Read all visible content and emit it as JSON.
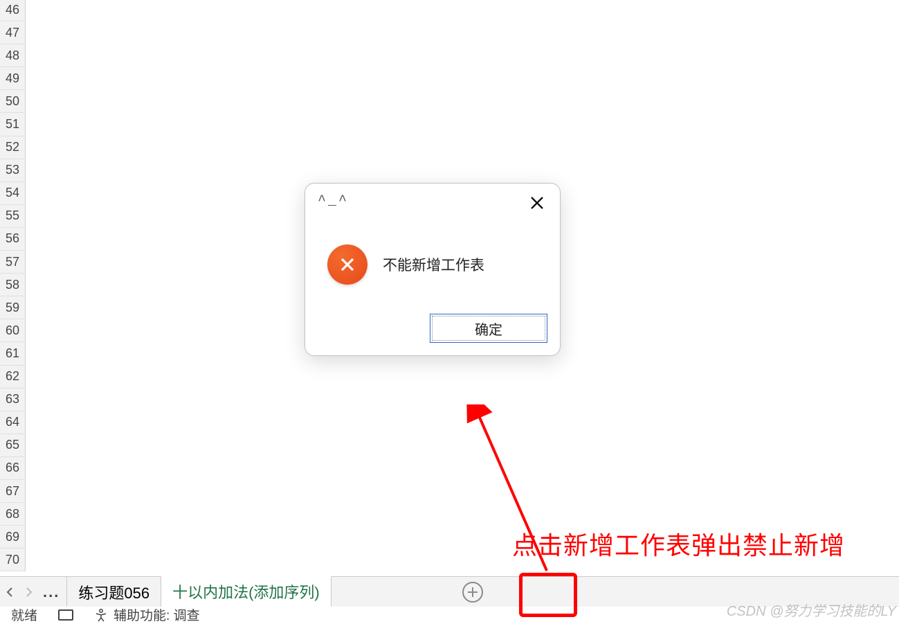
{
  "rows": {
    "start": 46,
    "end": 70
  },
  "tabs": {
    "tab1_label": "练习题056",
    "tab2_label": "十以内加法(添加序列)",
    "ellipsis": "..."
  },
  "dialog": {
    "title": "^_^",
    "message": "不能新增工作表",
    "ok_label": "确定"
  },
  "annotation": {
    "text": "点击新增工作表弹出禁止新增"
  },
  "status": {
    "ready": "就绪",
    "accessibility": "辅助功能: 调查"
  },
  "watermark": "CSDN @努力学习技能的LY"
}
